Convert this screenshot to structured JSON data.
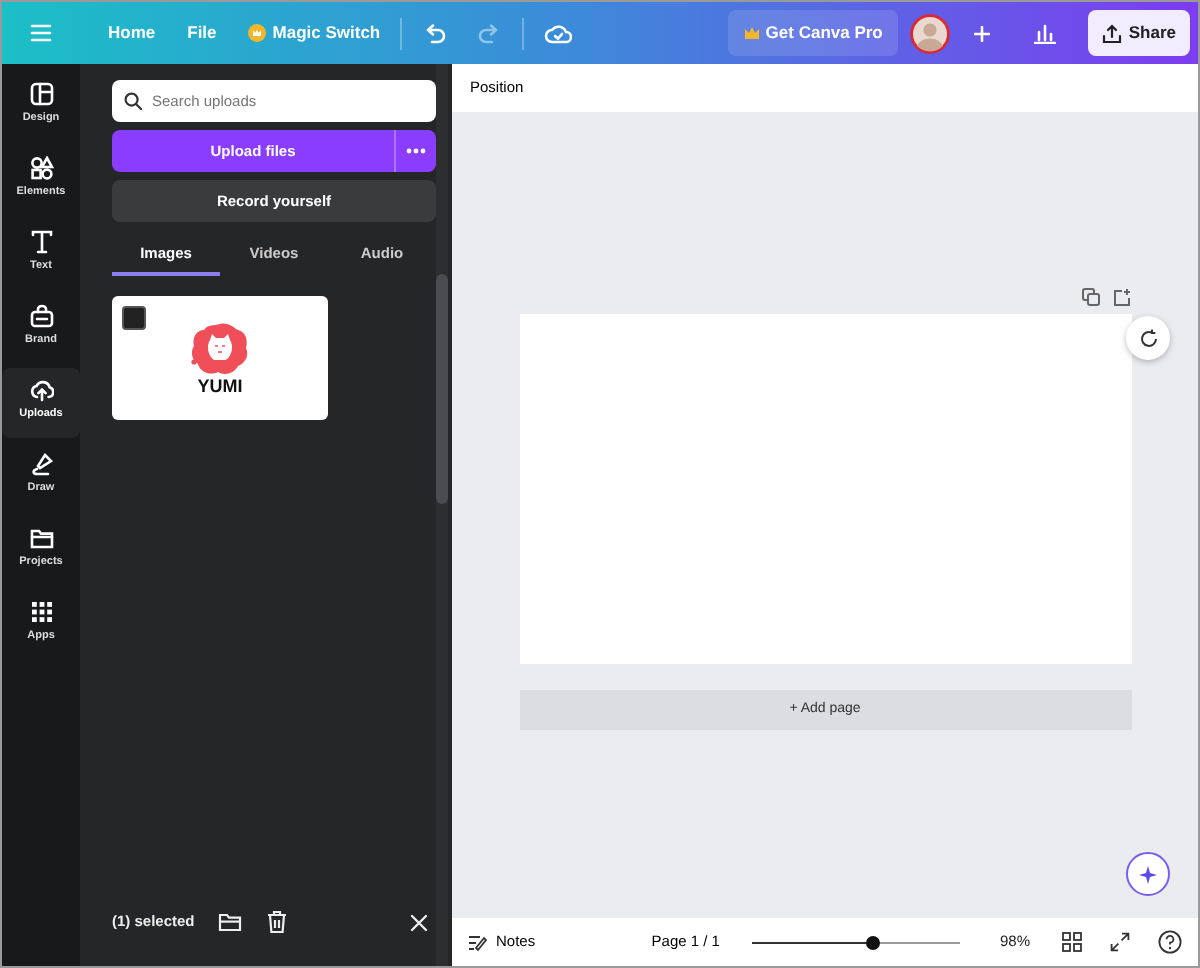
{
  "topbar": {
    "nav": [
      "Home",
      "File"
    ],
    "magic_switch": "Magic Switch",
    "get_pro": "Get Canva Pro",
    "share": "Share"
  },
  "rail": [
    {
      "label": "Design",
      "selected": false
    },
    {
      "label": "Elements",
      "selected": false
    },
    {
      "label": "Text",
      "selected": false
    },
    {
      "label": "Brand",
      "selected": false
    },
    {
      "label": "Uploads",
      "selected": true
    },
    {
      "label": "Draw",
      "selected": false
    },
    {
      "label": "Projects",
      "selected": false
    },
    {
      "label": "Apps",
      "selected": false
    }
  ],
  "panel": {
    "search": {
      "placeholder": "Search uploads"
    },
    "upload_button": "Upload files",
    "record_button": "Record yourself",
    "tabs": [
      {
        "label": "Images",
        "selected": true
      },
      {
        "label": "Videos",
        "selected": false
      },
      {
        "label": "Audio",
        "selected": false
      }
    ],
    "uploads": [
      {
        "caption": "YUMI"
      }
    ],
    "selection_bar": {
      "count": "(1) selected"
    }
  },
  "canvas": {
    "toolbar_label": "Position",
    "add_page": "+ Add page"
  },
  "footer": {
    "notes": "Notes",
    "page": "Page 1 / 1",
    "zoom": {
      "level": 0.58
    },
    "zoom_reading": "98%"
  }
}
